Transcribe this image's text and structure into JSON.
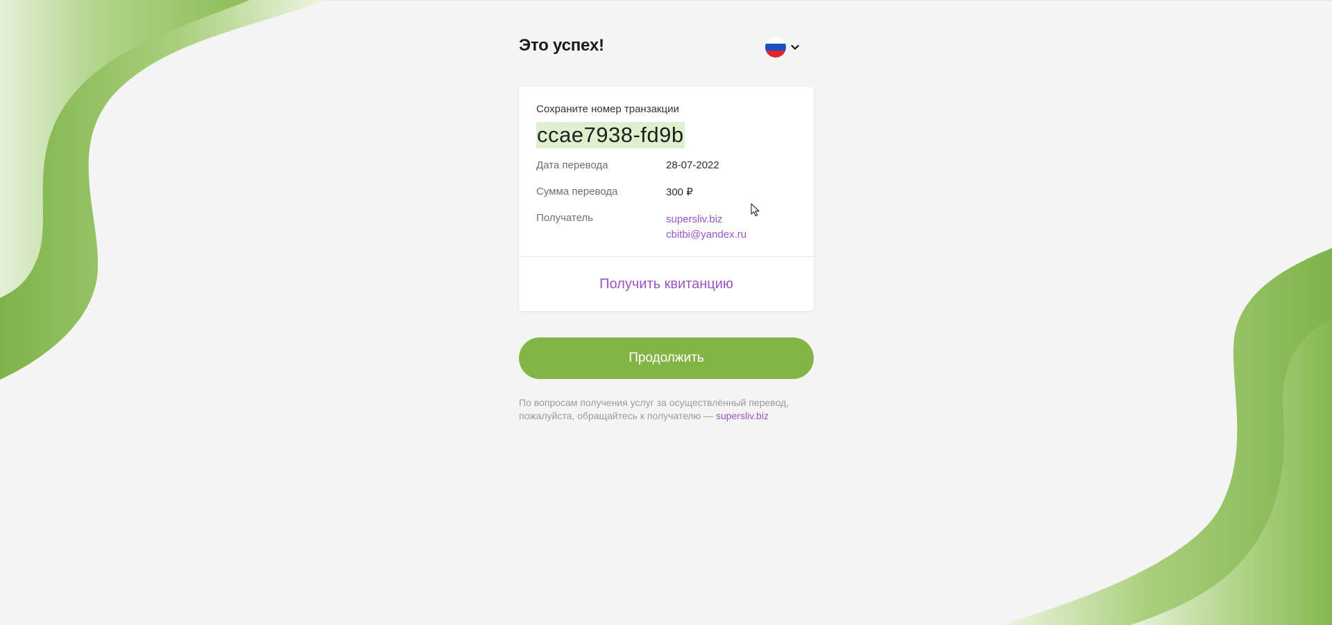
{
  "header": {
    "title": "Это успех!",
    "language_flag": "ru-flag-icon"
  },
  "card": {
    "save_label": "Сохраните номер транзакции",
    "transaction_id": "ccae7938-fd9b",
    "rows": [
      {
        "label": "Дата перевода",
        "value": "28-07-2022"
      },
      {
        "label": "Сумма перевода",
        "value": "300 ₽"
      }
    ],
    "recipient": {
      "label": "Получатель",
      "site": "supersliv.biz",
      "email": "cbitbi@yandex.ru"
    },
    "receipt_label": "Получить квитанцию"
  },
  "continue_label": "Продолжить",
  "note": {
    "text": "По вопросам получения услуг за осуществлённый перевод, пожалуйста, обращайтесь к получателю —",
    "link": "supersliv.biz"
  },
  "colors": {
    "accent_green": "#82b545",
    "link_purple": "#9b52c9",
    "highlight": "#dff0cf",
    "background": "#f4f4f4"
  }
}
